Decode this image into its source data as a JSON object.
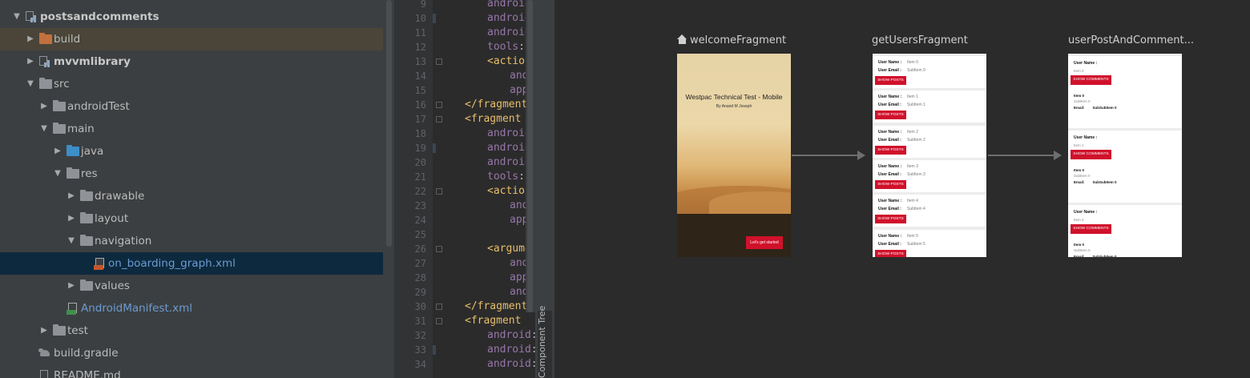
{
  "project_tree": {
    "rows": [
      {
        "label": "postsandcomments"
      },
      {
        "label": "build"
      },
      {
        "label": "mvvmlibrary"
      },
      {
        "label": "src"
      },
      {
        "label": "androidTest"
      },
      {
        "label": "main"
      },
      {
        "label": "java"
      },
      {
        "label": "res"
      },
      {
        "label": "drawable"
      },
      {
        "label": "layout"
      },
      {
        "label": "navigation"
      },
      {
        "label": "on_boarding_graph.xml"
      },
      {
        "label": "values"
      },
      {
        "label": "AndroidManifest.xml"
      },
      {
        "label": "test"
      },
      {
        "label": "build.gradle"
      },
      {
        "label": "README.md"
      }
    ]
  },
  "editor": {
    "line_numbers": [
      "9",
      "10",
      "11",
      "12",
      "13",
      "14",
      "15",
      "16",
      "17",
      "18",
      "19",
      "20",
      "21",
      "22",
      "23",
      "24",
      "25",
      "26",
      "27",
      "28",
      "29",
      "30",
      "31",
      "32",
      "33",
      "34"
    ],
    "lines": [
      {
        "tag": "",
        "ns": "android",
        "rest": ":i"
      },
      {
        "tag": "",
        "ns": "android",
        "rest": ":n"
      },
      {
        "tag": "",
        "ns": "android",
        "rest": ":l"
      },
      {
        "tag": "",
        "ns": "tools",
        "rest": ":lay"
      },
      {
        "tag": "<action",
        "ns": "",
        "rest": ""
      },
      {
        "tag": "",
        "ns": "andro",
        "rest": ""
      },
      {
        "tag": "",
        "ns": "app",
        "rest": ":d"
      },
      {
        "tag": "</fragment>",
        "ns": "",
        "rest": ""
      },
      {
        "tag": "<fragment",
        "ns": "",
        "rest": ""
      },
      {
        "tag": "",
        "ns": "android",
        "rest": ":i"
      },
      {
        "tag": "",
        "ns": "android",
        "rest": ":n"
      },
      {
        "tag": "",
        "ns": "android",
        "rest": ":l"
      },
      {
        "tag": "",
        "ns": "tools",
        "rest": ":lay"
      },
      {
        "tag": "<action",
        "ns": "",
        "rest": ""
      },
      {
        "tag": "",
        "ns": "andro",
        "rest": ""
      },
      {
        "tag": "",
        "ns": "app",
        "rest": ":d"
      },
      {
        "tag": "",
        "ns": "",
        "rest": ""
      },
      {
        "tag": "<argument",
        "ns": "",
        "rest": ""
      },
      {
        "tag": "",
        "ns": "andro",
        "rest": ""
      },
      {
        "tag": "",
        "ns": "app",
        "rest": ":a"
      },
      {
        "tag": "",
        "ns": "andro",
        "rest": ""
      },
      {
        "tag": "</fragment>",
        "ns": "",
        "rest": ""
      },
      {
        "tag": "<fragment",
        "ns": "",
        "rest": ""
      },
      {
        "tag": "",
        "ns": "android",
        "rest": ":i"
      },
      {
        "tag": "",
        "ns": "android",
        "rest": ":n"
      },
      {
        "tag": "",
        "ns": "android",
        "rest": ":l"
      }
    ]
  },
  "component_tree_tab": {
    "label": "Component Tree"
  },
  "nav_graph": {
    "destinations": {
      "welcome": {
        "title": "welcomeFragment",
        "headline": "Westpac Technical Test - Mobile",
        "byline": "By Anand M Joseph",
        "button": "Let's get started"
      },
      "users": {
        "title": "getUsersFragment",
        "name_label": "User Name :",
        "email_label": "User Email :",
        "button": "SHOW POSTS",
        "cards": [
          {
            "name": "Item 0",
            "email": "SubItem 0"
          },
          {
            "name": "Item 1",
            "email": "SubItem 1"
          },
          {
            "name": "Item 2",
            "email": "SubItem 2"
          },
          {
            "name": "Item 3",
            "email": "SubItem 3"
          },
          {
            "name": "Item 4",
            "email": "SubItem 4"
          },
          {
            "name": "Item 5",
            "email": "SubItem 5"
          }
        ]
      },
      "posts": {
        "title": "userPostAndComment...",
        "name_label": "User Name :",
        "button": "SHOW COMMENTS",
        "email_label": "Email:",
        "cards": [
          {
            "item": "Item 0",
            "title": "Item 0",
            "subtitle": "SubItem 0",
            "comment": "SubSubItem 0"
          },
          {
            "item": "Item 1",
            "title": "Item 0",
            "subtitle": "SubItem 0",
            "comment": "SubSubItem 0"
          },
          {
            "item": "Item 2",
            "title": "Item 0",
            "subtitle": "SubItem 0",
            "comment": "SubSubItem 0"
          }
        ]
      }
    }
  }
}
